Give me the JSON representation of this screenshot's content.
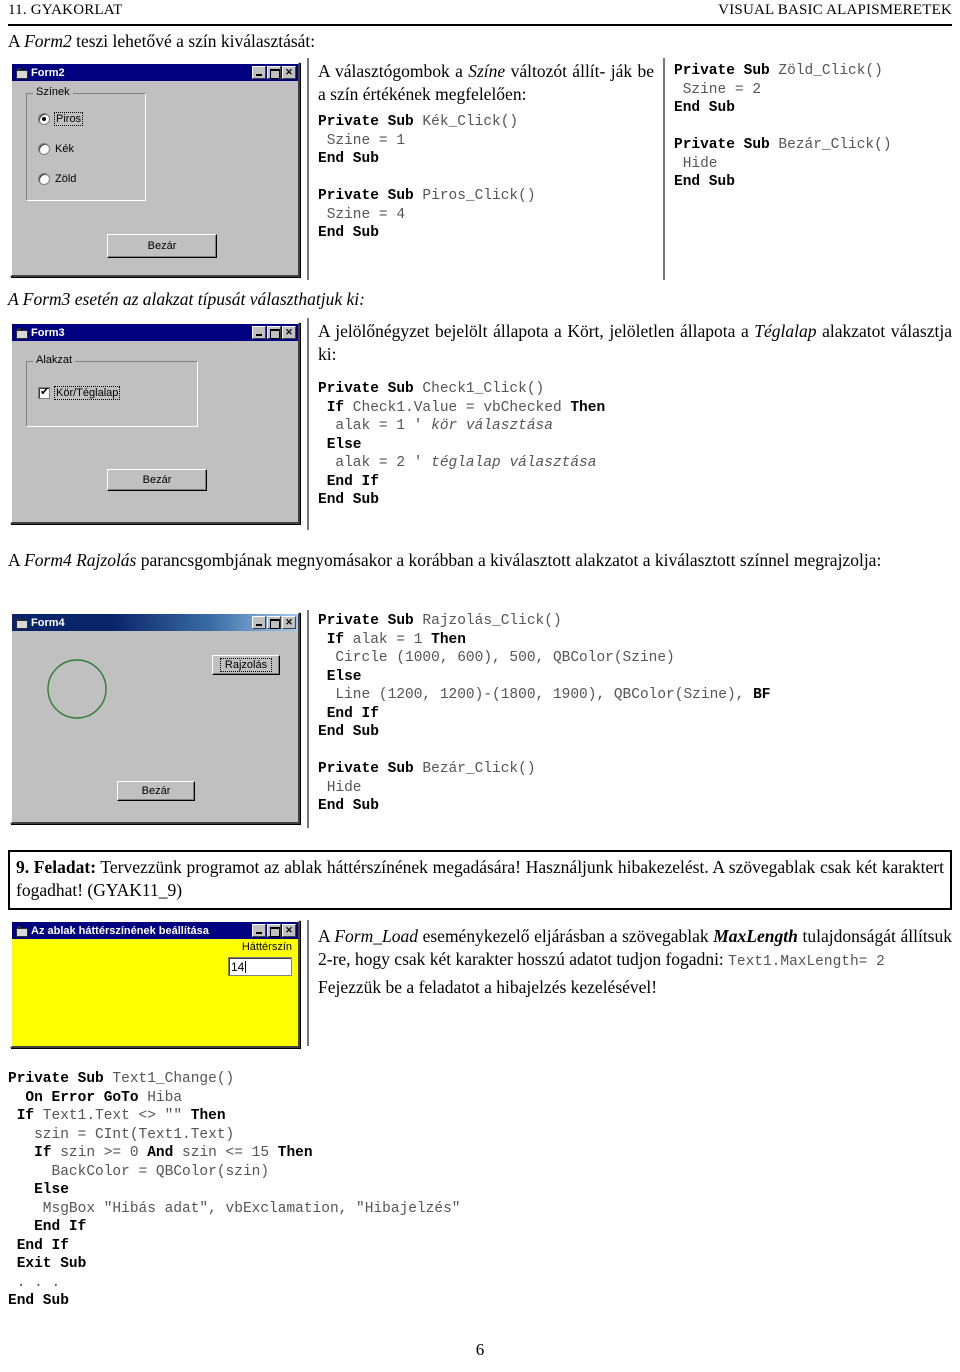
{
  "header": {
    "left": "11. GYAKORLAT",
    "right": "VISUAL BASIC ALAPISMERETEK"
  },
  "intro_form2": {
    "prefix": "A ",
    "emph": "Form2",
    "rest": " teszi lehetővé a szín kiválasztását:"
  },
  "form2": {
    "title": "Form2",
    "frame_legend": "Színek",
    "options": [
      {
        "label": "Piros",
        "checked": true
      },
      {
        "label": "Kék",
        "checked": false
      },
      {
        "label": "Zöld",
        "checked": false
      }
    ],
    "close_button": "Bezár",
    "buttons": {
      "minimize": "_",
      "maximize": "□",
      "close": "✕"
    }
  },
  "form2_note": {
    "line1_a": "A választógombok a ",
    "line1_i": "Színe",
    "line1_b": " változót állít-",
    "line2": "ják be a szín értékének megfelelően:"
  },
  "code_form2_left": "Private Sub Kék_Click()\n Szine = 1\nEnd Sub\n\nPrivate Sub Piros_Click()\n Szine = 4\nEnd Sub",
  "code_form2_right": "Private Sub Zöld_Click()\n Szine = 2\nEnd Sub\n\nPrivate Sub Bezár_Click()\n Hide\nEnd Sub",
  "intro_form3": "A Form3 esetén az alakzat típusát választhatjuk ki:",
  "form3": {
    "title": "Form3",
    "frame_legend": "Alakzat",
    "checkbox": {
      "label": "Kör/Téglalap",
      "checked": true
    },
    "close_button": "Bezár",
    "buttons": {
      "minimize": "_",
      "maximize": "□",
      "close": "✕"
    }
  },
  "form3_note": {
    "line1_a": "A jelölőnégyzet bejelölt állapota a Kört, jelöletlen állapota a ",
    "line1_i": "Téglalap",
    "line2": "alakzatot választja ki:"
  },
  "code_form3": "Private Sub Check1_Click()\n If Check1.Value = vbChecked Then\n  alak = 1 ' kör választása\n Else\n  alak = 2 ' téglalap választása\n End If\nEnd Sub",
  "intro_form4": {
    "a": "A ",
    "i": "Form4 Rajzolás",
    "b": " parancsgombjának megnyomásakor a korábban a kiválasztott alakzatot a kiválasztott színnel megrajzolja:"
  },
  "form4": {
    "title": "Form4",
    "draw_button": "Rajzolás",
    "close_button": "Bezár",
    "circle_color": "#2e7d32",
    "buttons": {
      "minimize": "_",
      "maximize": "□",
      "close": "✕"
    }
  },
  "code_form4": "Private Sub Rajzolás_Click()\n If alak = 1 Then\n  Circle (1000, 600), 500, QBColor(Szine)\n Else\n  Line (1200, 1200)-(1800, 1900), QBColor(Szine), BF\n End If\nEnd Sub\n\nPrivate Sub Bezár_Click()\n Hide\nEnd Sub",
  "task9": {
    "label": "9. Feladat:",
    "text": " Tervezzünk programot az ablak háttérszínének megadására! Használjunk hibakezelést. A szövegablak csak két karaktert fogadhat! (GYAK11_9)"
  },
  "form9": {
    "title": "Az ablak háttérszínének beállítása",
    "label": "Háttérszín",
    "textbox_value": "14",
    "background_color": "#ffff00",
    "buttons": {
      "minimize": "_",
      "maximize": "□",
      "close": "✕"
    }
  },
  "form9_note": {
    "l1_a": "A ",
    "l1_i": "Form_Load",
    "l1_b": " eseménykezelő eljárásban a szövegablak ",
    "l1_bi": "MaxLength",
    "l2": "tulajdonságát állítsuk 2-re, hogy csak két karakter hosszú adatot tudjon",
    "l3_a": "fogadni: ",
    "l3_code": "Text1.MaxLength= 2",
    "l4": "Fejezzük be a feladatot a hibajelzés kezelésével!"
  },
  "code_task9": "Private Sub Text1_Change()\n  On Error GoTo Hiba\n If Text1.Text <> \"\" Then\n   szin = CInt(Text1.Text)\n   If szin >= 0 And szin <= 15 Then\n     BackColor = QBColor(szin)\n   Else\n    MsgBox \"Hibás adat\", vbExclamation, \"Hibajelzés\"\n   End If\n End If\n Exit Sub\n . . .\nEnd Sub",
  "page_number": "6"
}
